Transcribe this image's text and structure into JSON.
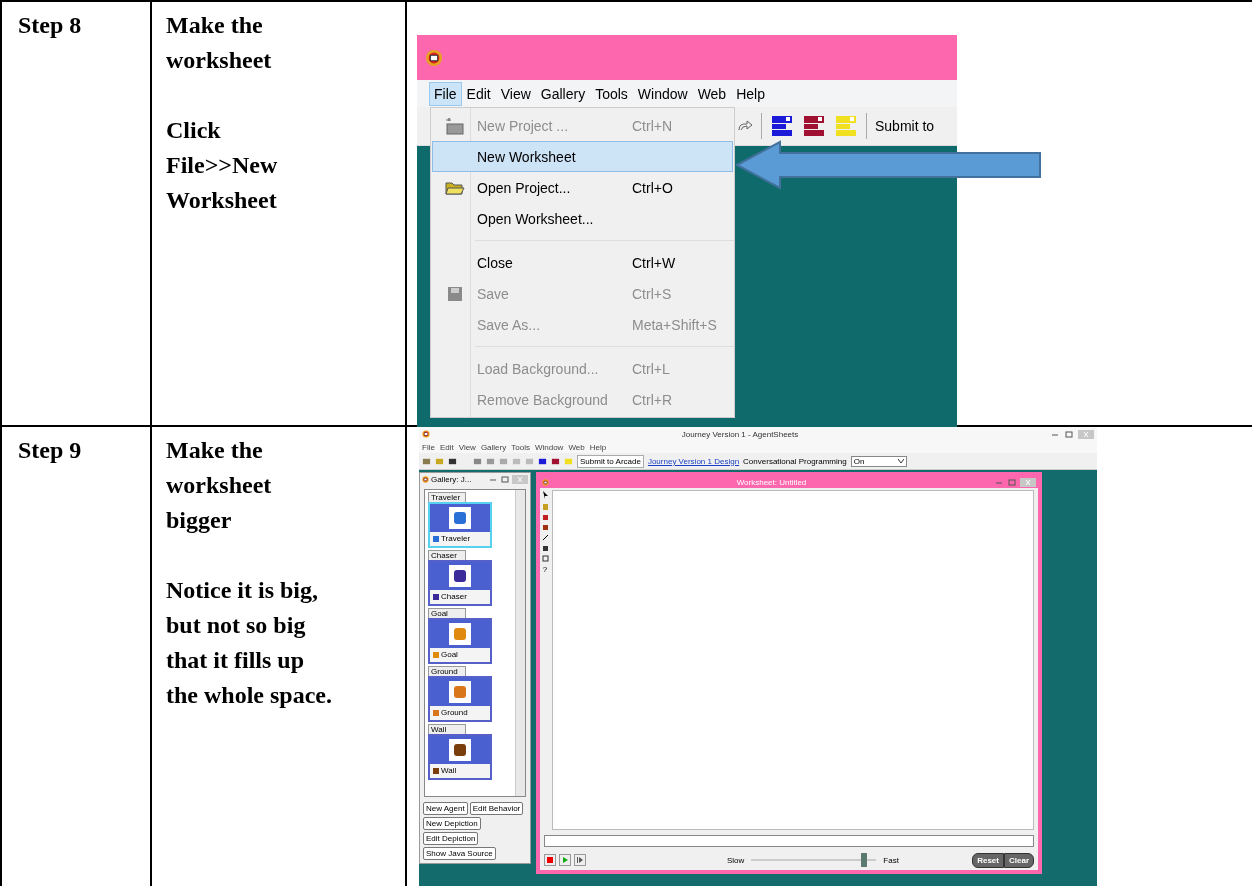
{
  "rows": [
    {
      "step": "Step 8",
      "paragraphs": [
        {
          "lines": [
            "Make the",
            "worksheet"
          ]
        },
        {
          "lines": [
            "Click",
            "File>>New",
            "Worksheet"
          ]
        }
      ]
    },
    {
      "step": "Step 9",
      "paragraphs": [
        {
          "lines": [
            "Make the",
            "worksheet",
            "bigger"
          ]
        },
        {
          "lines": [
            "Notice it is big,",
            "but not so big",
            "that it fills up",
            "the whole space."
          ]
        }
      ]
    }
  ],
  "file_menu_screenshot": {
    "menubar": [
      {
        "label": "File",
        "selected": true
      },
      {
        "label": "Edit",
        "selected": false
      },
      {
        "label": "View",
        "selected": false
      },
      {
        "label": "Gallery",
        "selected": false
      },
      {
        "label": "Tools",
        "selected": false
      },
      {
        "label": "Window",
        "selected": false
      },
      {
        "label": "Web",
        "selected": false
      },
      {
        "label": "Help",
        "selected": false
      }
    ],
    "toolbar_text": "Submit to",
    "menu_items": [
      {
        "kind": "item",
        "label": "New Project ...",
        "shortcut": "Ctrl+N",
        "disabled": true,
        "selected": false
      },
      {
        "kind": "item",
        "label": "New Worksheet",
        "disabled": false,
        "selected": true
      },
      {
        "kind": "item",
        "label": "Open Project...",
        "shortcut": "Ctrl+O",
        "disabled": false,
        "selected": false
      },
      {
        "kind": "item",
        "label": "Open Worksheet...",
        "disabled": false,
        "selected": false
      },
      {
        "kind": "separator"
      },
      {
        "kind": "item",
        "label": "Close",
        "shortcut": "Ctrl+W",
        "disabled": false,
        "selected": false
      },
      {
        "kind": "item",
        "label": "Save",
        "shortcut": "Ctrl+S",
        "disabled": true,
        "selected": false
      },
      {
        "kind": "item",
        "label": "Save As...",
        "shortcut": "Meta+Shift+S",
        "disabled": true,
        "selected": false
      },
      {
        "kind": "separator"
      },
      {
        "kind": "item",
        "label": "Load Background...",
        "shortcut": "Ctrl+L",
        "disabled": true,
        "selected": false
      },
      {
        "kind": "item",
        "label": "Remove Background",
        "shortcut": "Ctrl+R",
        "disabled": true,
        "selected": false
      }
    ]
  },
  "worksheet_screenshot": {
    "window_title": "Journey Version 1 - AgentSheets",
    "menubar": [
      "File",
      "Edit",
      "View",
      "Gallery",
      "Tools",
      "Window",
      "Web",
      "Help"
    ],
    "submit_button": "Submit to Arcade",
    "design_link": "Journey Version 1 Design",
    "conversational_label": "Conversational Programming",
    "conversational_value": "On",
    "gallery": {
      "title": "Gallery: J...",
      "agents": [
        {
          "tab": "Traveler",
          "name": "Traveler",
          "selected": true,
          "color": "#2a6fd6"
        },
        {
          "tab": "Chaser",
          "name": "Chaser",
          "selected": false,
          "color": "#3a2a9a"
        },
        {
          "tab": "Goal",
          "name": "Goal",
          "selected": false,
          "color": "#e08a10"
        },
        {
          "tab": "Ground",
          "name": "Ground",
          "selected": false,
          "color": "#d8761a"
        },
        {
          "tab": "Wall",
          "name": "Wall",
          "selected": false,
          "color": "#7a3d0c"
        }
      ],
      "buttons": [
        "New Agent",
        "Edit Behavior",
        "New Depiction",
        "Edit Depiction",
        "Show Java Source"
      ]
    },
    "worksheet": {
      "title": "Worksheet: Untitled",
      "help_tool": "?",
      "slow_label": "Slow",
      "fast_label": "Fast",
      "speed": {
        "level": 0.9
      },
      "buttons": [
        "Reset",
        "Clear"
      ]
    }
  }
}
